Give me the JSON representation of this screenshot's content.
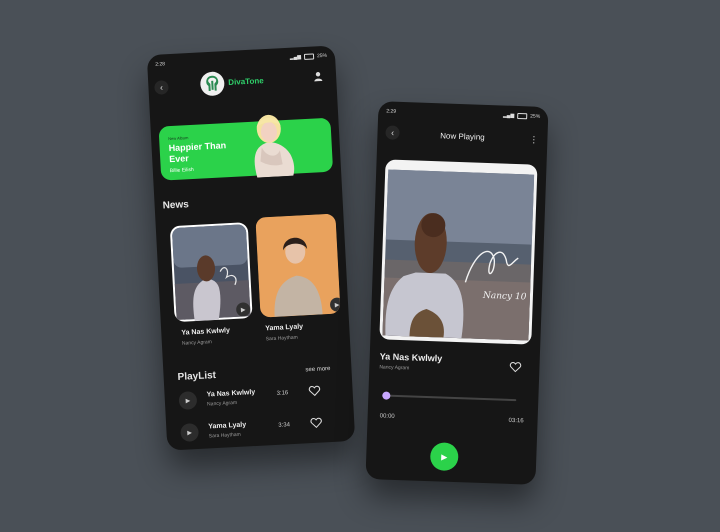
{
  "colors": {
    "background": "#4a5057",
    "phone": "#161616",
    "accent": "#2bd24a",
    "brand": "#2fd06a",
    "progress": "#c8a8ff"
  },
  "home": {
    "status": {
      "time": "2:28",
      "battery": "25%"
    },
    "app_name": "DivaTone",
    "banner": {
      "eyebrow": "New Album",
      "title": "Happier Than Ever",
      "artist": "Billie Eilish"
    },
    "news_heading": "News",
    "news": [
      {
        "title": "Ya Nas Kwlwly",
        "artist": "Nancy Agram"
      },
      {
        "title": "Yama Lyaly",
        "artist": "Sara Haytham"
      }
    ],
    "playlist_heading": "PlayList",
    "see_more": "see more",
    "playlist": [
      {
        "title": "Ya Nas Kwlwly",
        "artist": "Nancy Agram",
        "duration": "3:16"
      },
      {
        "title": "Yama Lyaly",
        "artist": "Sara Haytham",
        "duration": "3:34"
      }
    ]
  },
  "player": {
    "status": {
      "time": "2:29",
      "battery": "25%"
    },
    "title": "Now Playing",
    "song": "Ya Nas Kwlwly",
    "artist": "Nancy Agram",
    "artwork_caption": "Nancy 10",
    "progress": 0.03,
    "time_current": "00:00",
    "time_total": "03:16"
  }
}
